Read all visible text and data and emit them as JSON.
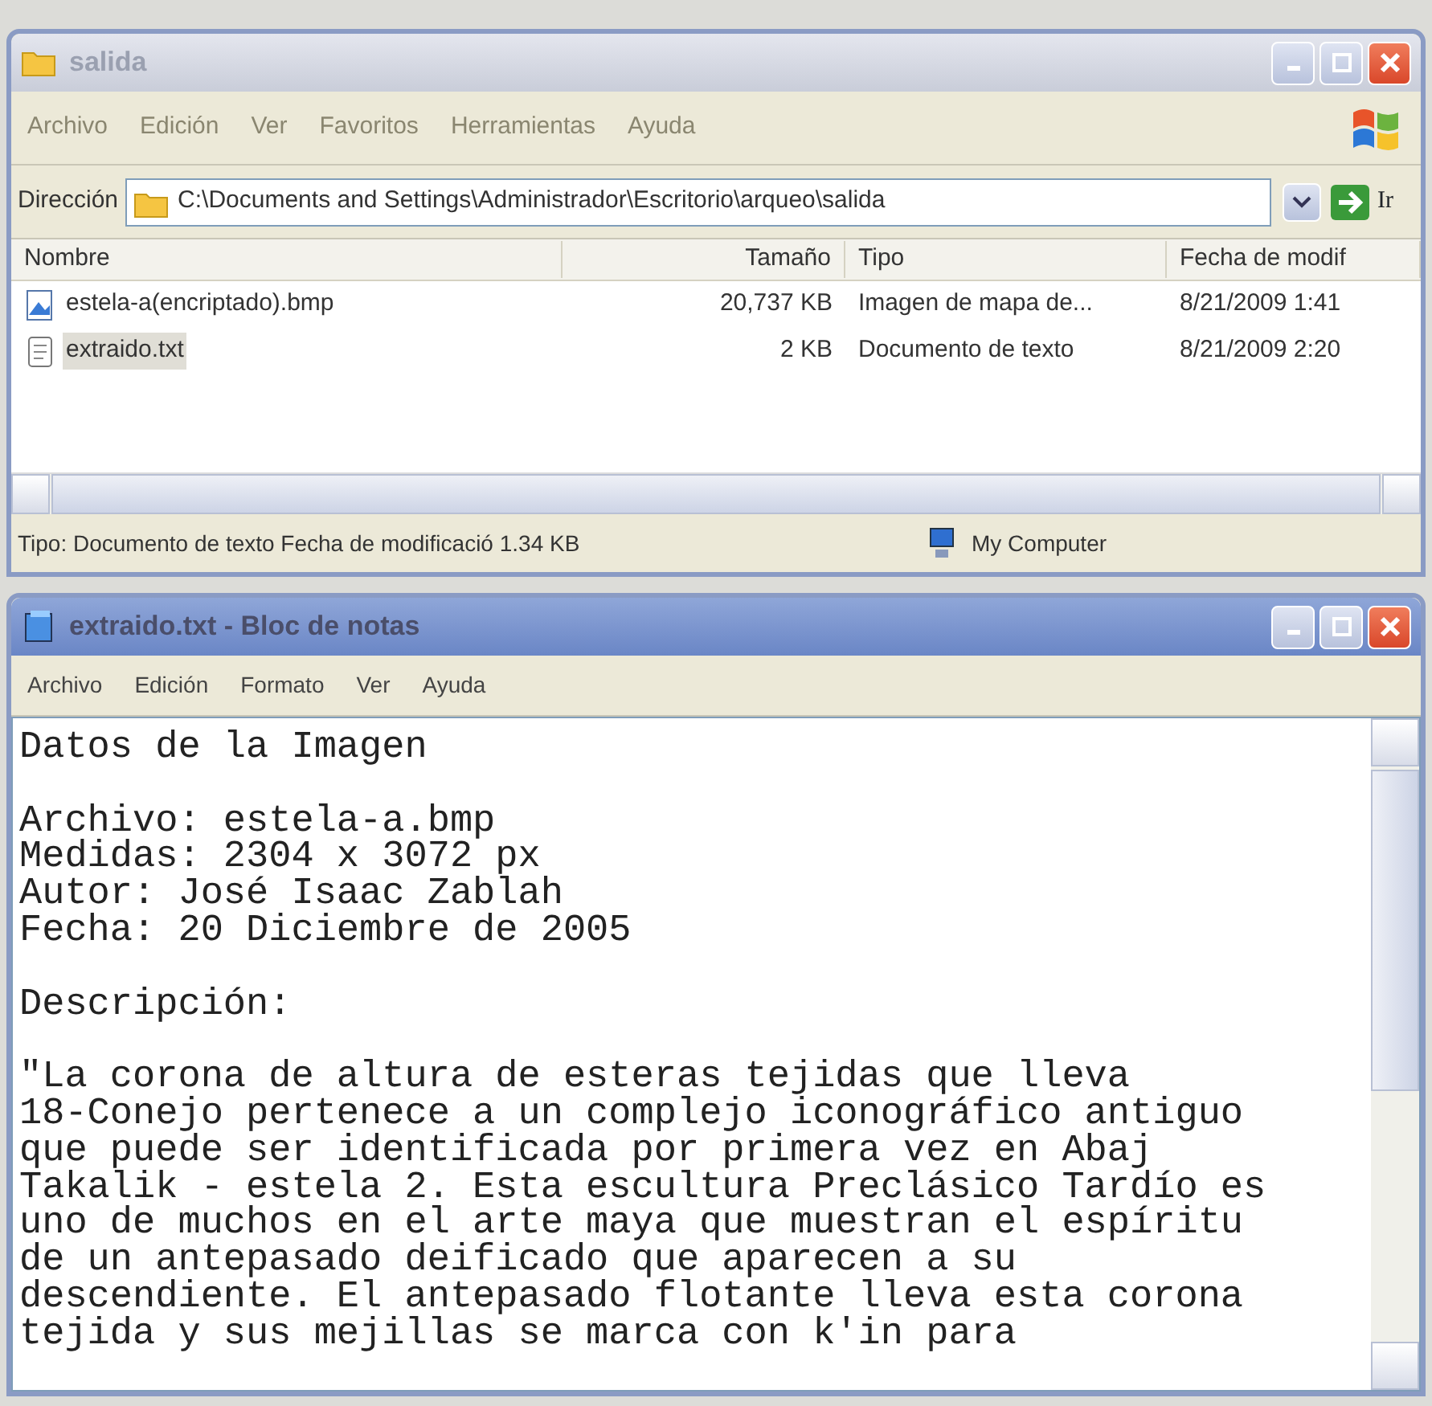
{
  "explorer": {
    "title": "salida",
    "menu": [
      "Archivo",
      "Edición",
      "Ver",
      "Favoritos",
      "Herramientas",
      "Ayuda"
    ],
    "address": {
      "label": "Dirección",
      "value": "C:\\Documents and Settings\\Administrador\\Escritorio\\arqueo\\salida",
      "go": "Ir"
    },
    "columns": [
      "Nombre",
      "Tamaño",
      "Tipo",
      "Fecha de modif"
    ],
    "rows": [
      {
        "kind": "image",
        "name": "estela-a(encriptado).bmp",
        "size": "20,737 KB",
        "type": "Imagen de mapa de...",
        "date": "8/21/2009 1:41",
        "selected": false
      },
      {
        "kind": "text",
        "name": "extraido.txt",
        "size": "2 KB",
        "type": "Documento de texto",
        "date": "8/21/2009 2:20",
        "selected": true
      }
    ],
    "status": {
      "info": "Tipo: Documento de texto Fecha de modificació 1.34 KB",
      "zone": "My Computer"
    }
  },
  "notepad": {
    "title": "extraido.txt - Bloc de notas",
    "menu": [
      "Archivo",
      "Edición",
      "Formato",
      "Ver",
      "Ayuda"
    ],
    "paragraphs": [
      [
        "Datos de la Imagen"
      ],
      [
        "Archivo: estela-a.bmp",
        "Medidas: 2304 x 3072 px",
        "Autor: José Isaac Zablah",
        "Fecha: 20 Diciembre de 2005"
      ],
      [
        "Descripción:"
      ],
      [
        "\"La corona de altura de esteras tejidas que lleva",
        "18-Conejo pertenece a un complejo iconográfico antiguo",
        "que puede ser identificada por primera vez en Abaj",
        "Takalik - estela 2. Esta escultura Preclásico Tardío es",
        "uno de muchos en el arte maya que muestran el espíritu",
        "de un antepasado deificado que aparecen a su",
        "descendiente. El antepasado flotante lleva esta corona",
        "tejida y sus mejillas se marca con k'in para"
      ]
    ]
  }
}
